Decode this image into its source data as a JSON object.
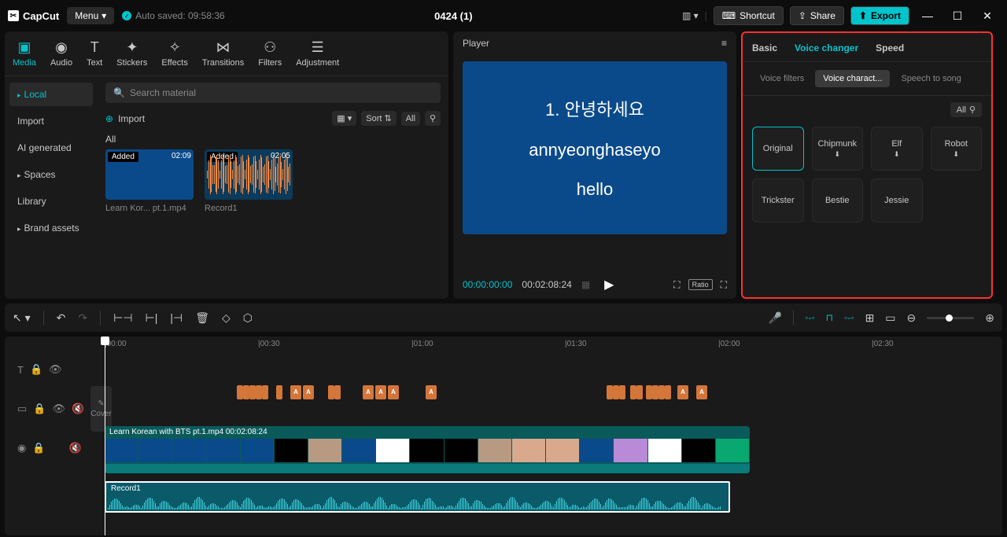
{
  "title_bar": {
    "logo": "CapCut",
    "menu": "Menu",
    "autosave": "Auto saved: 09:58:36",
    "project": "0424 (1)",
    "shortcut": "Shortcut",
    "share": "Share",
    "export": "Export"
  },
  "media_tabs": [
    "Media",
    "Audio",
    "Text",
    "Stickers",
    "Effects",
    "Transitions",
    "Filters",
    "Adjustment"
  ],
  "media_sidebar": [
    "Local",
    "Import",
    "AI generated",
    "Spaces",
    "Library",
    "Brand assets"
  ],
  "search_placeholder": "Search material",
  "import_label": "Import",
  "sort_label": "Sort",
  "all_label": "All",
  "clips": [
    {
      "badge": "Added",
      "time": "02:09",
      "name": "Learn Kor... pt.1.mp4",
      "type": "video"
    },
    {
      "badge": "Added",
      "time": "02:05",
      "name": "Record1",
      "type": "audio"
    }
  ],
  "player": {
    "title": "Player",
    "line1": "1. 안녕하세요",
    "line2": "annyeonghaseyo",
    "line3": "hello",
    "current": "00:00:00:00",
    "total": "00:02:08:24",
    "ratio": "Ratio"
  },
  "props": {
    "tabs": [
      "Basic",
      "Voice changer",
      "Speed"
    ],
    "subtabs": [
      "Voice filters",
      "Voice charact...",
      "Speech to song"
    ],
    "all": "All",
    "voices": [
      "Original",
      "Chipmunk",
      "Elf",
      "Robot",
      "Trickster",
      "Bestie",
      "Jessie"
    ]
  },
  "timeline": {
    "ruler": [
      "00:00",
      "00:30",
      "01:00",
      "01:30",
      "02:00",
      "02:30"
    ],
    "video_label": "Learn Korean with BTS pt.1.mp4   00:02:08:24",
    "audio_label": "Record1",
    "cover": "Cover",
    "frame_colors": [
      "#0b4a8a",
      "#0b4a8a",
      "#0b4a8a",
      "#0b4a8a",
      "#0b4a8a",
      "#000",
      "#b89a82",
      "#0b4a8a",
      "#fff",
      "#000",
      "#000",
      "#b89a82",
      "#d8a98c",
      "#d8a98c",
      "#0b4a8a",
      "#b88ad8",
      "#fff",
      "#000",
      "#09a870"
    ]
  }
}
